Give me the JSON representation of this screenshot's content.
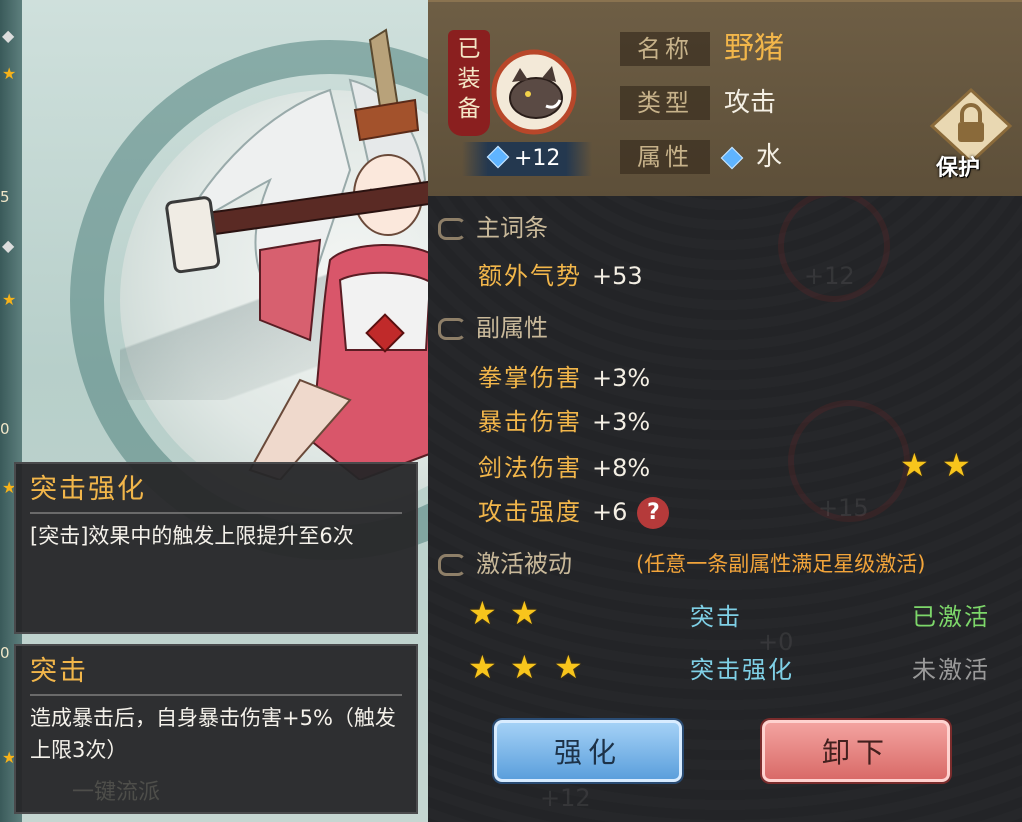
{
  "equipment": {
    "equipped_label": "已装备",
    "enhance_level": "+12",
    "name_label": "名称",
    "name": "野猪",
    "type_label": "类型",
    "type": "攻击",
    "element_label": "属性",
    "element": "水",
    "protect_label": "保护"
  },
  "main_attribute": {
    "title": "主词条",
    "name": "额外气势",
    "value": "+53"
  },
  "sub_attributes": {
    "title": "副属性",
    "items": [
      {
        "name": "拳掌伤害",
        "value": "+3%"
      },
      {
        "name": "暴击伤害",
        "value": "+3%"
      },
      {
        "name": "剑法伤害",
        "value": "+8%"
      },
      {
        "name": "攻击强度",
        "value": "+6"
      }
    ],
    "help_icon": "?",
    "star_rating": 2
  },
  "passives": {
    "title": "激活被动",
    "hint": "(任意一条副属性满足星级激活)",
    "items": [
      {
        "stars": 2,
        "name": "突击",
        "status": "已激活"
      },
      {
        "stars": 3,
        "name": "突击强化",
        "status": "未激活"
      }
    ]
  },
  "buttons": {
    "enhance": "强化",
    "unequip": "卸下"
  },
  "skills": [
    {
      "title": "突击强化",
      "desc": "[突击]效果中的触发上限提升至6次"
    },
    {
      "title": "突击",
      "desc": "造成暴击后，自身暴击伤害+5%（触发上限3次）"
    }
  ],
  "left_strip": {
    "numbers": [
      "5",
      "0",
      "0"
    ]
  },
  "background_text": {
    "watermark": "一键流派",
    "ghost_level_1": "+12",
    "ghost_level_2": "+15",
    "ghost_level_3": "+12",
    "ghost_level_4": "+0"
  },
  "colors": {
    "gold": "#f2b64a",
    "active_green": "#7dd76a",
    "inactive_gray": "#9a9a9a",
    "passive_blue": "#7fd0e6",
    "enhance_blue": "#5b9fdc",
    "unequip_red": "#d96a68"
  },
  "icons": [
    "boar-icon",
    "diamond-icon",
    "lock-icon",
    "swirl-icon",
    "star-icon",
    "question-icon"
  ]
}
